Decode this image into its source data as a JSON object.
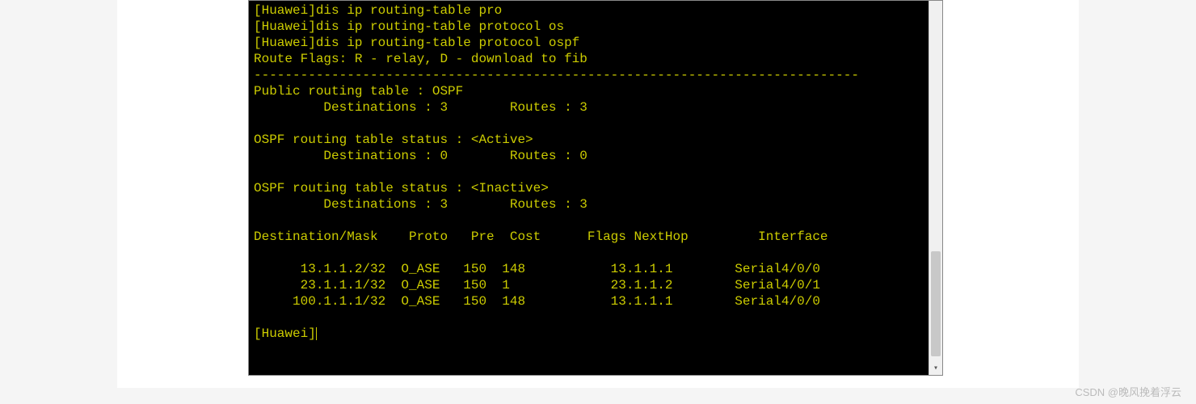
{
  "terminal": {
    "lines": {
      "l0": "[Huawei]dis ip routing-table pro",
      "l1": "[Huawei]dis ip routing-table protocol os",
      "l2": "[Huawei]dis ip routing-table protocol ospf",
      "l3": "Route Flags: R - relay, D - download to fib",
      "l4": "------------------------------------------------------------------------------",
      "l5": "Public routing table : OSPF",
      "l6": "         Destinations : 3        Routes : 3",
      "l7": "",
      "l8": "OSPF routing table status : <Active>",
      "l9": "         Destinations : 0        Routes : 0",
      "l10": "",
      "l11": "OSPF routing table status : <Inactive>",
      "l12": "         Destinations : 3        Routes : 3",
      "l13": "",
      "header": "Destination/Mask    Proto   Pre  Cost      Flags NextHop         Interface",
      "l15": "",
      "r0": "      13.1.1.2/32  O_ASE   150  148           13.1.1.1        Serial4/0/0",
      "r1": "      23.1.1.1/32  O_ASE   150  1             23.1.1.2        Serial4/0/1",
      "r2": "     100.1.1.1/32  O_ASE   150  148           13.1.1.1        Serial4/0/0",
      "l19": "",
      "prompt": "[Huawei]"
    }
  },
  "routes": [
    {
      "destination": "13.1.1.2/32",
      "proto": "O_ASE",
      "pre": 150,
      "cost": 148,
      "flags": "",
      "nexthop": "13.1.1.1",
      "interface": "Serial4/0/0"
    },
    {
      "destination": "23.1.1.1/32",
      "proto": "O_ASE",
      "pre": 150,
      "cost": 1,
      "flags": "",
      "nexthop": "23.1.1.2",
      "interface": "Serial4/0/1"
    },
    {
      "destination": "100.1.1.1/32",
      "proto": "O_ASE",
      "pre": 150,
      "cost": 148,
      "flags": "",
      "nexthop": "13.1.1.1",
      "interface": "Serial4/0/0"
    }
  ],
  "summary": {
    "public": {
      "destinations": 3,
      "routes": 3
    },
    "active": {
      "destinations": 0,
      "routes": 0
    },
    "inactive": {
      "destinations": 3,
      "routes": 3
    }
  },
  "watermark": "CSDN @晚风挽着浮云",
  "scrollbar": {
    "arrowDown": "▾"
  }
}
